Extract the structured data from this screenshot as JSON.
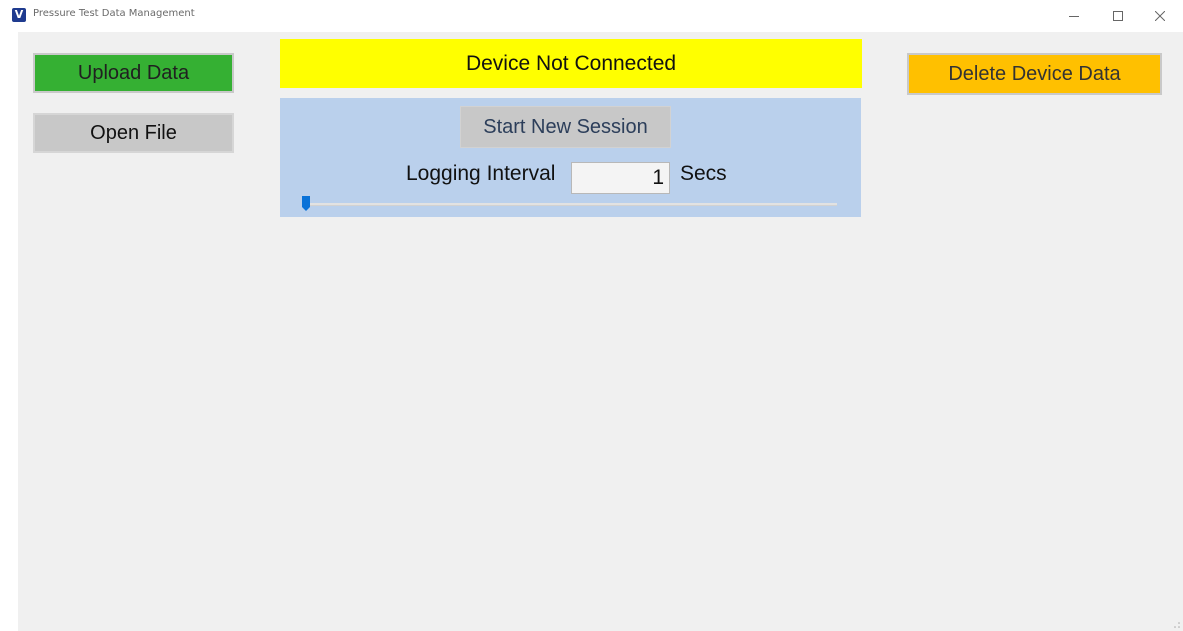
{
  "window": {
    "title": "Pressure Test Data Management",
    "app_icon_glyph": "V",
    "controls": {
      "minimize": "minimize-icon",
      "maximize": "maximize-icon",
      "close": "close-icon"
    }
  },
  "toolbar": {
    "upload_label": "Upload Data",
    "open_label": "Open File",
    "delete_label": "Delete Device Data"
  },
  "status": {
    "text": "Device Not Connected",
    "color": "#ffff00"
  },
  "session": {
    "start_label": "Start New Session",
    "interval_label": "Logging Interval",
    "interval_value": "1",
    "interval_unit": "Secs",
    "slider_value": 1
  },
  "colors": {
    "upload": "#35b033",
    "delete": "#ffc000",
    "panel": "#bad0ec",
    "slider_thumb": "#0a72d8"
  }
}
